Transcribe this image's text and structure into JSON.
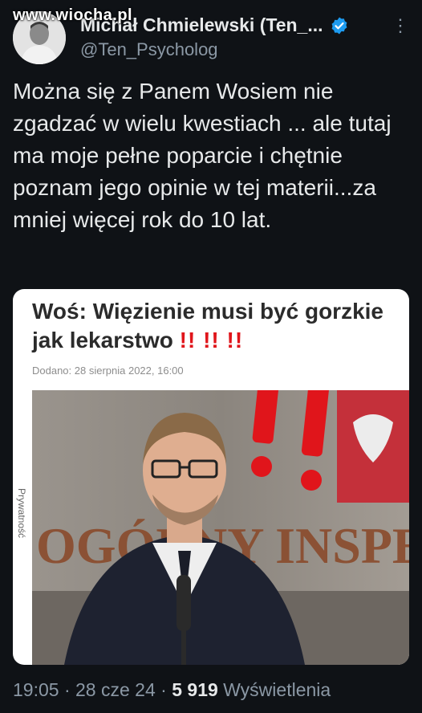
{
  "watermark": "www.wiocha.pl",
  "author": {
    "display_name": "Michał Chmielewski (Ten_...",
    "handle": "@Ten_Psycholog"
  },
  "tweet": {
    "text": "Można się z Panem Wosiem nie zgadzać w wielu kwestiach ... ale tutaj ma moje pełne poparcie i chętnie poznam jego opinie w tej materii...za mniej więcej rok do 10 lat."
  },
  "card": {
    "headline": "Woś: Więzienie musi być gorzkie jak lekarstwo",
    "exclamations": "!! !! !!",
    "date": "Dodano: 28 sierpnia 2022,  16:00",
    "side_label": "Prywatność",
    "background_sign": "OGÓLNY INSPE"
  },
  "meta": {
    "time": "19:05",
    "date": "28 cze 24",
    "views_count": "5 919",
    "views_label": "Wyświetlenia"
  },
  "colors": {
    "background": "#0f1216",
    "text": "#e7e9ea",
    "secondary": "#8b98a5",
    "verified": "#1d9bf0",
    "accent_red": "#e0151b"
  }
}
